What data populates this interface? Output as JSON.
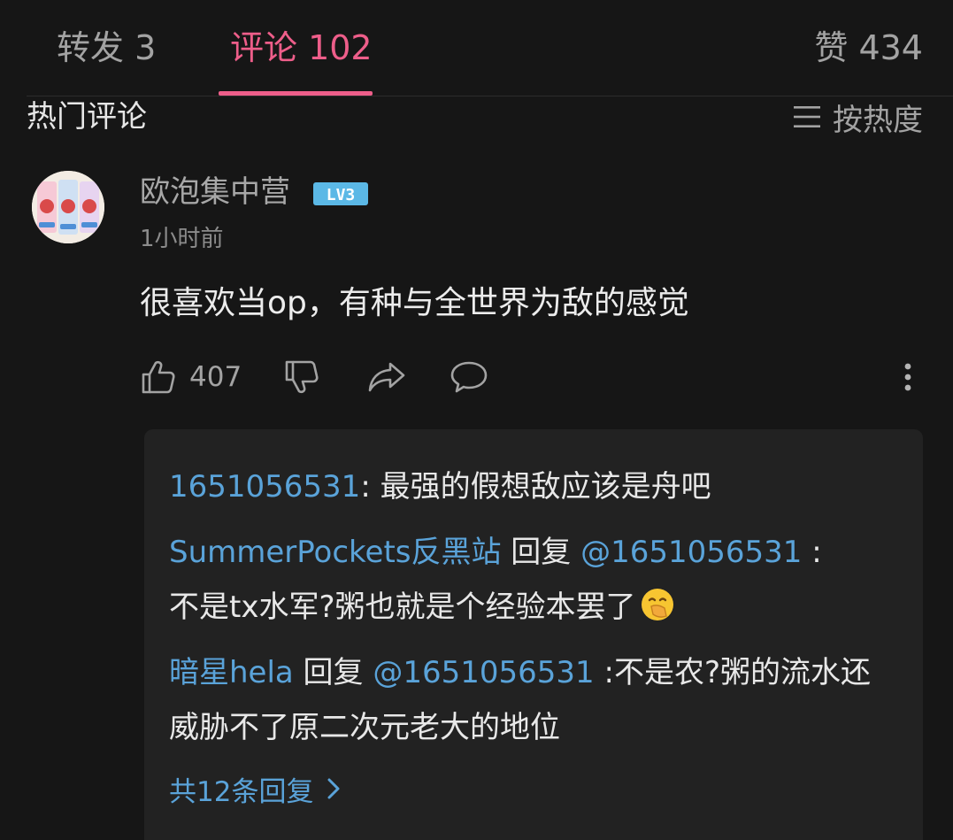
{
  "tabs": {
    "repost": "转发 3",
    "comments": "评论 102",
    "likes": "赞 434"
  },
  "section": {
    "title": "热门评论",
    "sort_label": "按热度"
  },
  "comment": {
    "username": "欧泡集中营",
    "level": "LV3",
    "time": "1小时前",
    "text": "很喜欢当op，有种与全世界为敌的感觉",
    "like_count": "407"
  },
  "replies": [
    {
      "author": "1651056531",
      "separator": ": ",
      "text": "最强的假想敌应该是舟吧"
    },
    {
      "author": "SummerPockets反黑站",
      "reply_word": " 回复 ",
      "mention": "@1651056531",
      "separator": " :",
      "text": "不是tx水军?粥也就是个经验本罢了"
    },
    {
      "author": "暗星hela",
      "reply_word": " 回复 ",
      "mention": "@1651056531",
      "separator": " :",
      "text": "不是农?粥的流水还威胁不了原二次元老大的地位"
    }
  ],
  "more_replies_label": "共12条回复",
  "icons": [
    "sort-icon",
    "thumbs-up-icon",
    "thumbs-down-icon",
    "share-icon",
    "comment-icon",
    "more-vertical-icon",
    "covering-mouth-emoji",
    "chevron-right-icon"
  ],
  "colors": {
    "background": "#161616",
    "accent": "#ee5e8a",
    "link": "#5aa3d9",
    "level_badge": "#5bb8e6"
  }
}
